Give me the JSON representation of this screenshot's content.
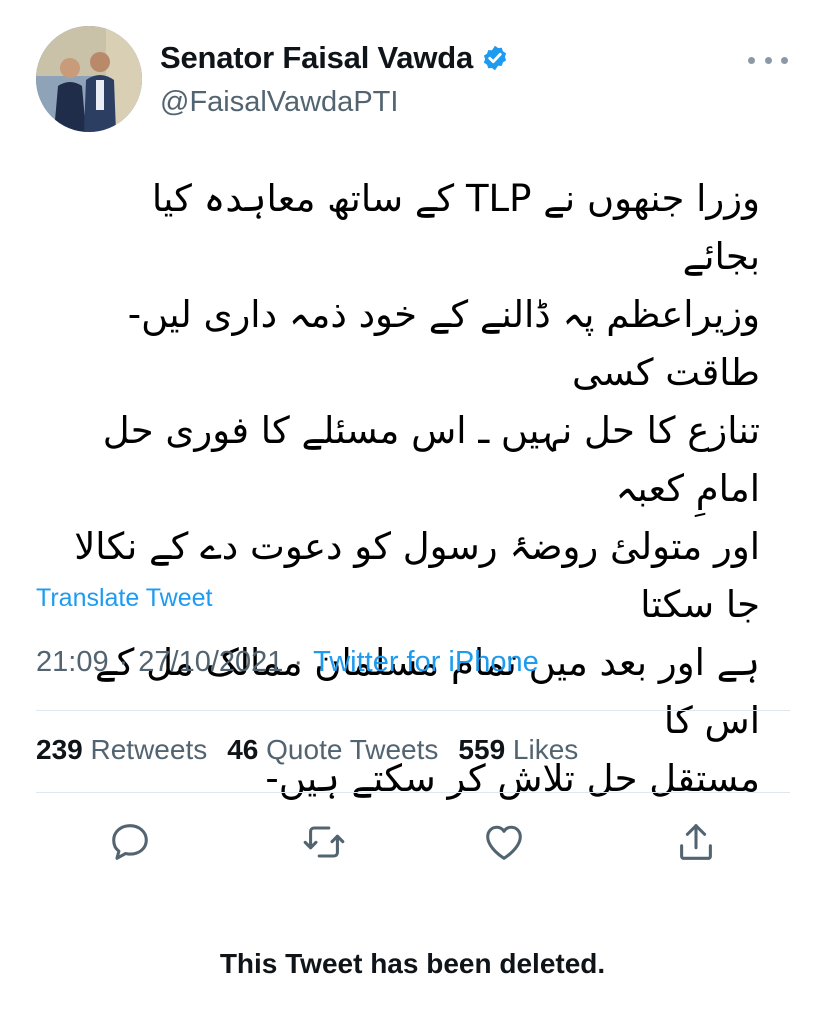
{
  "author": {
    "display_name": "Senator Faisal Vawda",
    "handle": "@FaisalVawdaPTI"
  },
  "tweet": {
    "text": "وزرا جنھوں نے TLP کے ساتھ معاہدہ کیا بجائے\nوزیراعظم پہ ڈالنے کے خود ذمہ داری لیں- طاقت کسی\nتنازع کا حل نہیں ـ اس مسئلے کا فوری حل امامِ کعبہ\nاور متولیٔ روضۂ رسول کو دعوت دے کے نکالا جا سکتا\nہے اور بعد میں تمام مسلمان ممالک مل کے اس کا\nمستقل حل تلاش کر سکتے ہیں-",
    "translate_label": "Translate Tweet",
    "time": "21:09",
    "date": "27/10/2021",
    "separator": "·",
    "source": "Twitter for iPhone"
  },
  "stats": {
    "retweets_count": "239",
    "retweets_label": "Retweets",
    "quote_count": "46",
    "quote_label": "Quote Tweets",
    "likes_count": "559",
    "likes_label": "Likes"
  },
  "actions": {
    "reply_icon": "reply-icon",
    "retweet_icon": "retweet-icon",
    "like_icon": "like-icon",
    "share_icon": "share-icon"
  },
  "notice": "This Tweet has been deleted.",
  "colors": {
    "accent": "#1d9bf0",
    "muted": "#536471",
    "text": "#0f1419",
    "divider": "#e1e8ed"
  }
}
